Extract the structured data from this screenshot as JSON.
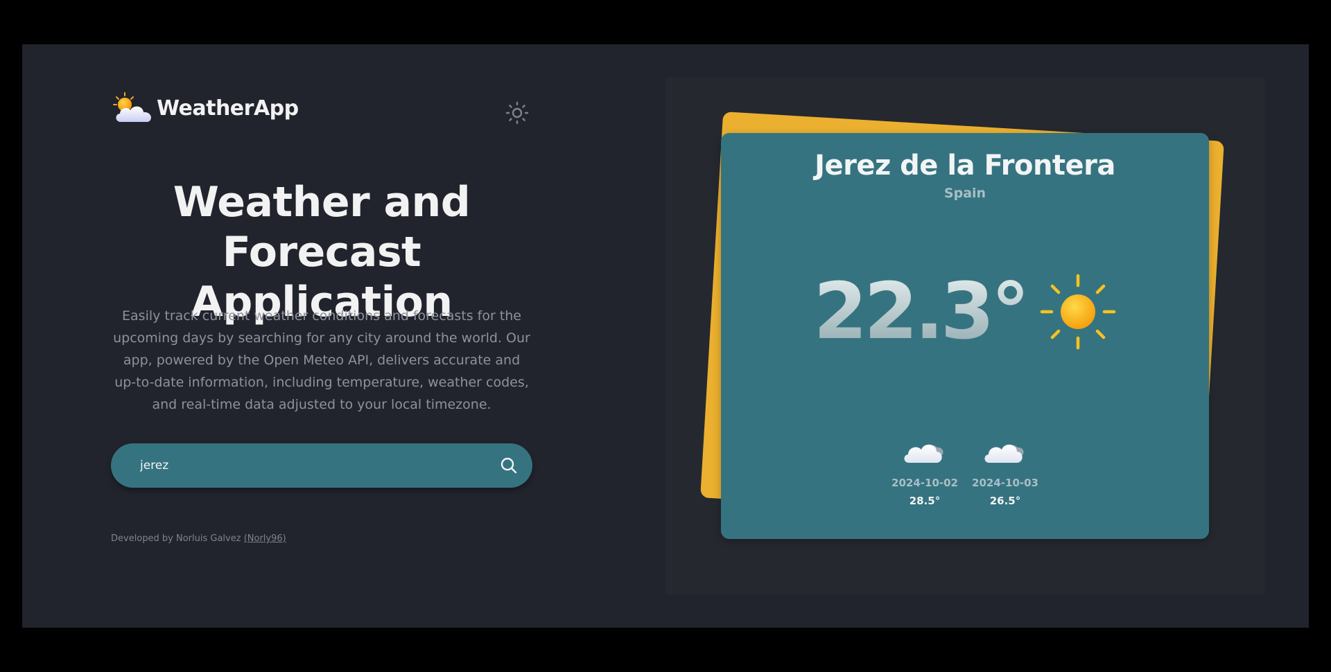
{
  "app": {
    "name": "WeatherApp",
    "logo_icon": "sun-behind-cloud-icon",
    "theme_toggle_icon": "sun-outline-icon"
  },
  "hero": {
    "title_line1": "Weather and",
    "title_line2": "Forecast Application",
    "description": "Easily track current weather conditions and forecasts for the upcoming days by searching for any city around the world. Our app, powered by the Open Meteo API, delivers accurate and up-to-date information, including temperature, weather codes, and real-time data adjusted to your local timezone."
  },
  "search": {
    "value": "jerez",
    "button_icon": "search-icon"
  },
  "footer": {
    "credit_prefix": "Developed by Norluis Galvez",
    "credit_link": "(Norly96)"
  },
  "weather": {
    "city": "Jerez de la Frontera",
    "country": "Spain",
    "current_temp": "22.3°",
    "current_icon": "sun-icon",
    "forecast": [
      {
        "date": "2024-10-02",
        "temp": "28.5°",
        "icon": "cloud-icon"
      },
      {
        "date": "2024-10-03",
        "temp": "26.5°",
        "icon": "cloud-icon"
      }
    ]
  },
  "colors": {
    "page_bg": "#21242d",
    "panel_bg": "#262830",
    "card_bg": "#367380",
    "accent_yellow": "#ebb02f",
    "search_bg": "#367380"
  }
}
